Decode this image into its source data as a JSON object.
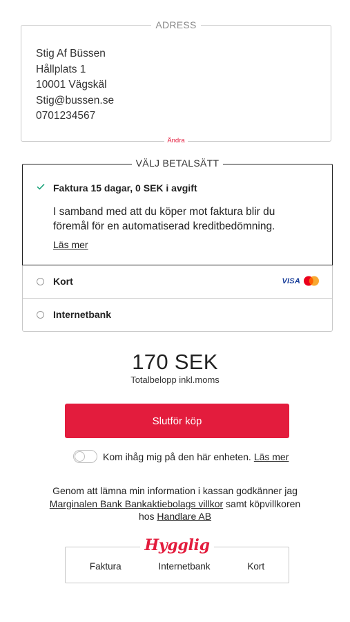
{
  "address": {
    "legend": "ADRESS",
    "name": "Stig Af Büssen",
    "street": "Hållplats 1",
    "city": "10001 Vägskäl",
    "email": "Stig@bussen.se",
    "phone": "0701234567",
    "change_link": "Ändra"
  },
  "payment": {
    "legend": "VÄLJ BETALSÄTT",
    "selected": {
      "title": "Faktura 15 dagar, 0 SEK i avgift",
      "description": "I samband med att du köper mot faktura blir du föremål för en automatiserad kreditbedömning.",
      "read_more": "Läs mer",
      "check_color": "#1aa37a"
    },
    "options": [
      {
        "label": "Kort",
        "logos": [
          "visa-icon",
          "mastercard-icon"
        ],
        "visa_text": "VISA"
      },
      {
        "label": "Internetbank"
      }
    ]
  },
  "total": {
    "amount": "170 SEK",
    "label": "Totalbelopp inkl.moms"
  },
  "buy_button": "Slutför köp",
  "remember": {
    "label": "Kom ihåg mig på den här enheten.",
    "link": "Läs mer",
    "enabled": false
  },
  "terms": {
    "prefix": "Genom att lämna min information i kassan godkänner jag",
    "link1": "Marginalen Bank Bankaktiebolags villkor",
    "middle": "samt köpvillkoren hos",
    "link2": "Handlare AB"
  },
  "hygglig": {
    "logo_text": "Hygglig",
    "methods": [
      "Faktura",
      "Internetbank",
      "Kort"
    ]
  },
  "colors": {
    "accent": "#e31c3d",
    "border": "#c8c8c8",
    "text": "#222222"
  }
}
